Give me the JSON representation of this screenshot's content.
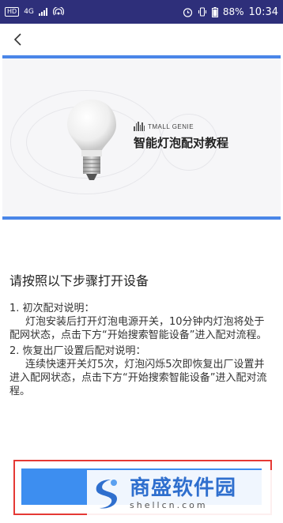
{
  "status_bar": {
    "hd_label": "HD",
    "network_label": "4G",
    "battery_text": "88%",
    "time": "10:34"
  },
  "nav": {
    "back_icon": "chevron-left-icon"
  },
  "hero": {
    "brand": "TMALL GENIE",
    "title": "智能灯泡配对教程"
  },
  "content": {
    "heading": "请按照以下步骤打开设备",
    "steps": [
      {
        "title": "1. 初次配对说明：",
        "body": "灯泡安装后打开灯泡电源开关，10分钟内灯泡将处于配网状态，点击下方“开始搜索智能设备”进入配对流程。"
      },
      {
        "title": "2. 恢复出厂设置后配对说明：",
        "body": "连续快速开关灯5次，灯泡闪烁5次即恢复出厂设置并进入配网状态，点击下方“开始搜索智能设备”进入配对流程。"
      }
    ]
  },
  "watermark": {
    "cn": "商盛软件园",
    "en": "shellcn.com"
  },
  "colors": {
    "status_bar": "#2e2f7a",
    "accent": "#4a86e8",
    "button": "#3d8ef0",
    "highlight_frame": "#e53935"
  }
}
